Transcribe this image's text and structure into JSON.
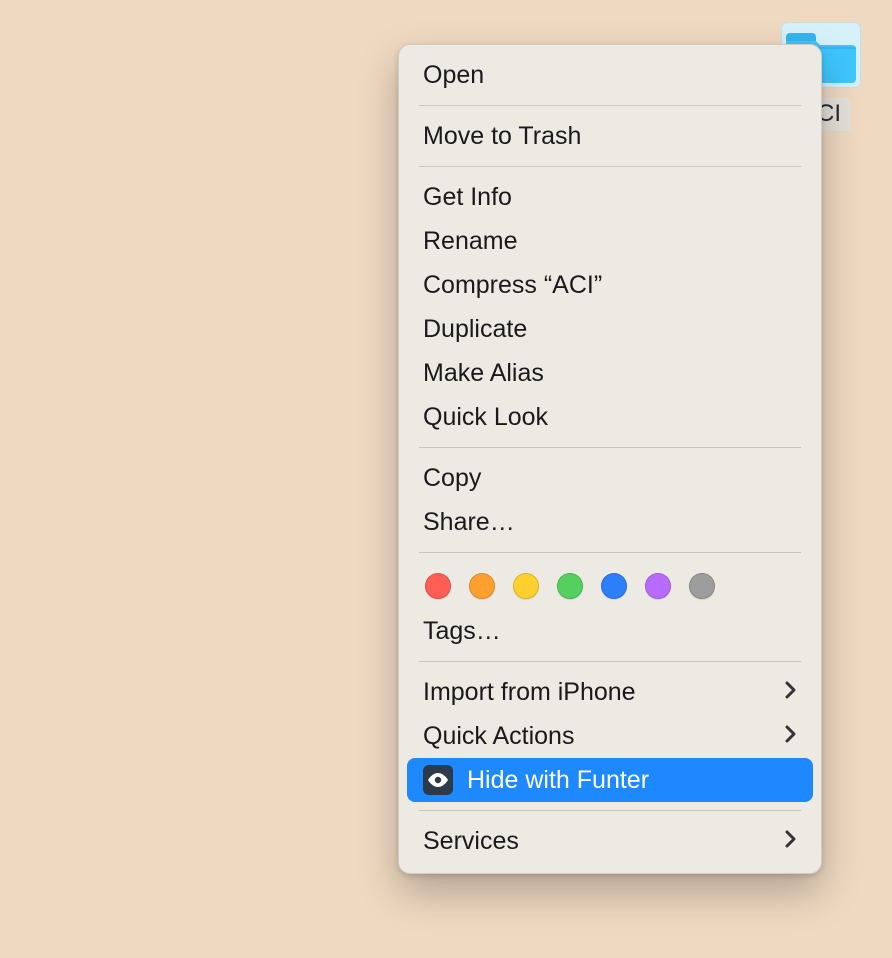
{
  "folder": {
    "name": "ACI"
  },
  "menu": {
    "open": "Open",
    "trash": "Move to Trash",
    "getinfo": "Get Info",
    "rename": "Rename",
    "compress": "Compress “ACI”",
    "duplicate": "Duplicate",
    "alias": "Make Alias",
    "quicklook": "Quick Look",
    "copy": "Copy",
    "share": "Share…",
    "tags": "Tags…",
    "import": "Import from iPhone",
    "quickactions": "Quick Actions",
    "hidefunter": "Hide with Funter",
    "services": "Services"
  },
  "tag_colors": [
    "#ff5e57",
    "#ff9f2e",
    "#ffd02e",
    "#53d060",
    "#2d7ff9",
    "#b86bff",
    "#9d9d9d"
  ]
}
